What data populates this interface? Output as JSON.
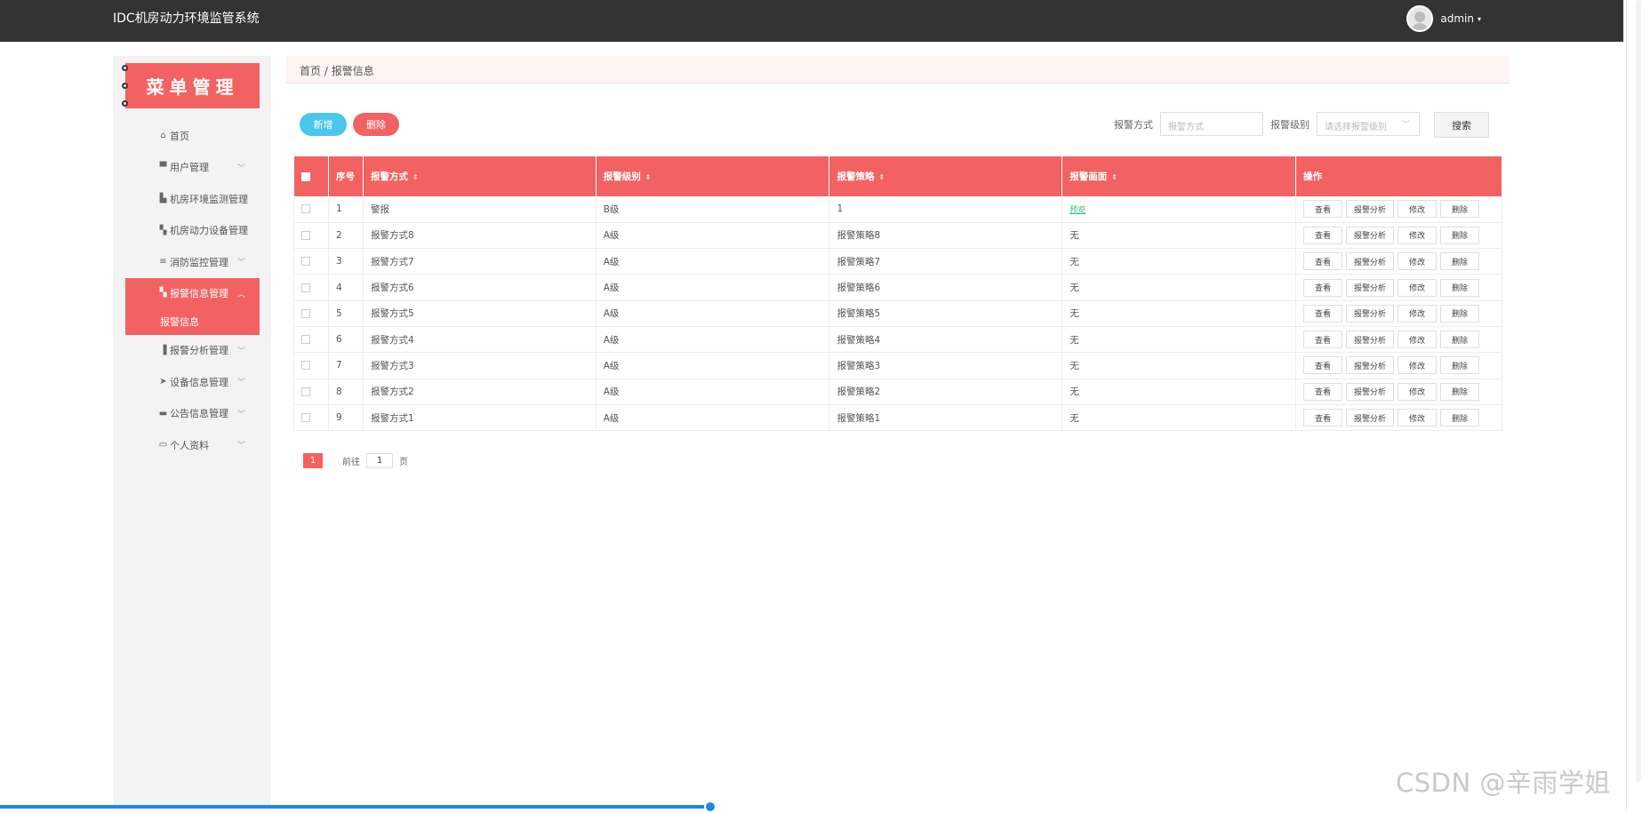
{
  "app": {
    "title": "IDC机房动力环境监管系统",
    "user": "admin",
    "user_caret": "▾"
  },
  "sidebar": {
    "header": "菜单管理",
    "items": [
      {
        "icon": "home-icon",
        "glyph": "⌂",
        "label": "首页",
        "chev": ""
      },
      {
        "icon": "user-icon",
        "glyph": "▀",
        "label": "用户管理",
        "chev": "﹀"
      },
      {
        "icon": "monitor-icon",
        "glyph": "▙",
        "label": "机房环境监测管理",
        "chev": ""
      },
      {
        "icon": "grid-icon",
        "glyph": "▚",
        "label": "机房动力设备管理",
        "chev": ""
      },
      {
        "icon": "list-icon",
        "glyph": "≡",
        "label": "消防监控管理",
        "chev": "﹀"
      }
    ],
    "active": {
      "icon": "grid-icon",
      "glyph": "▚",
      "label": "报警信息管理",
      "chev": "︿",
      "sub": "报警信息"
    },
    "items_after": [
      {
        "icon": "bar-chart-icon",
        "glyph": "▐",
        "label": "报警分析管理",
        "chev": "﹀"
      },
      {
        "icon": "send-icon",
        "glyph": "➤",
        "label": "设备信息管理",
        "chev": "﹀"
      },
      {
        "icon": "card-icon",
        "glyph": "▬",
        "label": "公告信息管理",
        "chev": "﹀"
      },
      {
        "icon": "profile-icon",
        "glyph": "▭",
        "label": "个人资料",
        "chev": "﹀"
      }
    ]
  },
  "breadcrumb": {
    "home": "首页",
    "sep": "/",
    "current": "报警信息"
  },
  "actions": {
    "add": "新增",
    "delete": "删除"
  },
  "search": {
    "method_label": "报警方式",
    "method_placeholder": "报警方式",
    "level_label": "报警级别",
    "level_placeholder": "请选择报警级别",
    "button": "搜索"
  },
  "table": {
    "headers": [
      "序号",
      "报警方式",
      "报警级别",
      "报警策略",
      "报警画面",
      "操作"
    ],
    "sort_glyph": "⇕",
    "op_labels": [
      "查看",
      "报警分析",
      "修改",
      "删除"
    ],
    "rows": [
      {
        "no": "1",
        "method": "警报",
        "level": "B级",
        "policy": "1",
        "image": "预览",
        "image_link": true
      },
      {
        "no": "2",
        "method": "报警方式8",
        "level": "A级",
        "policy": "报警策略8",
        "image": "无",
        "image_link": false
      },
      {
        "no": "3",
        "method": "报警方式7",
        "level": "A级",
        "policy": "报警策略7",
        "image": "无",
        "image_link": false
      },
      {
        "no": "4",
        "method": "报警方式6",
        "level": "A级",
        "policy": "报警策略6",
        "image": "无",
        "image_link": false
      },
      {
        "no": "5",
        "method": "报警方式5",
        "level": "A级",
        "policy": "报警策略5",
        "image": "无",
        "image_link": false
      },
      {
        "no": "6",
        "method": "报警方式4",
        "level": "A级",
        "policy": "报警策略4",
        "image": "无",
        "image_link": false
      },
      {
        "no": "7",
        "method": "报警方式3",
        "level": "A级",
        "policy": "报警策略3",
        "image": "无",
        "image_link": false
      },
      {
        "no": "8",
        "method": "报警方式2",
        "level": "A级",
        "policy": "报警策略2",
        "image": "无",
        "image_link": false
      },
      {
        "no": "9",
        "method": "报警方式1",
        "level": "A级",
        "policy": "报警策略1",
        "image": "无",
        "image_link": false
      }
    ]
  },
  "pagination": {
    "current": "1",
    "goto_label": "前往",
    "goto_value": "1",
    "page_suffix": "页"
  },
  "watermark": "CSDN @辛雨学姐",
  "colors": {
    "primary": "#f36262",
    "accent": "#4bc6ec",
    "topbar": "#333333",
    "link": "#2fbf71"
  }
}
